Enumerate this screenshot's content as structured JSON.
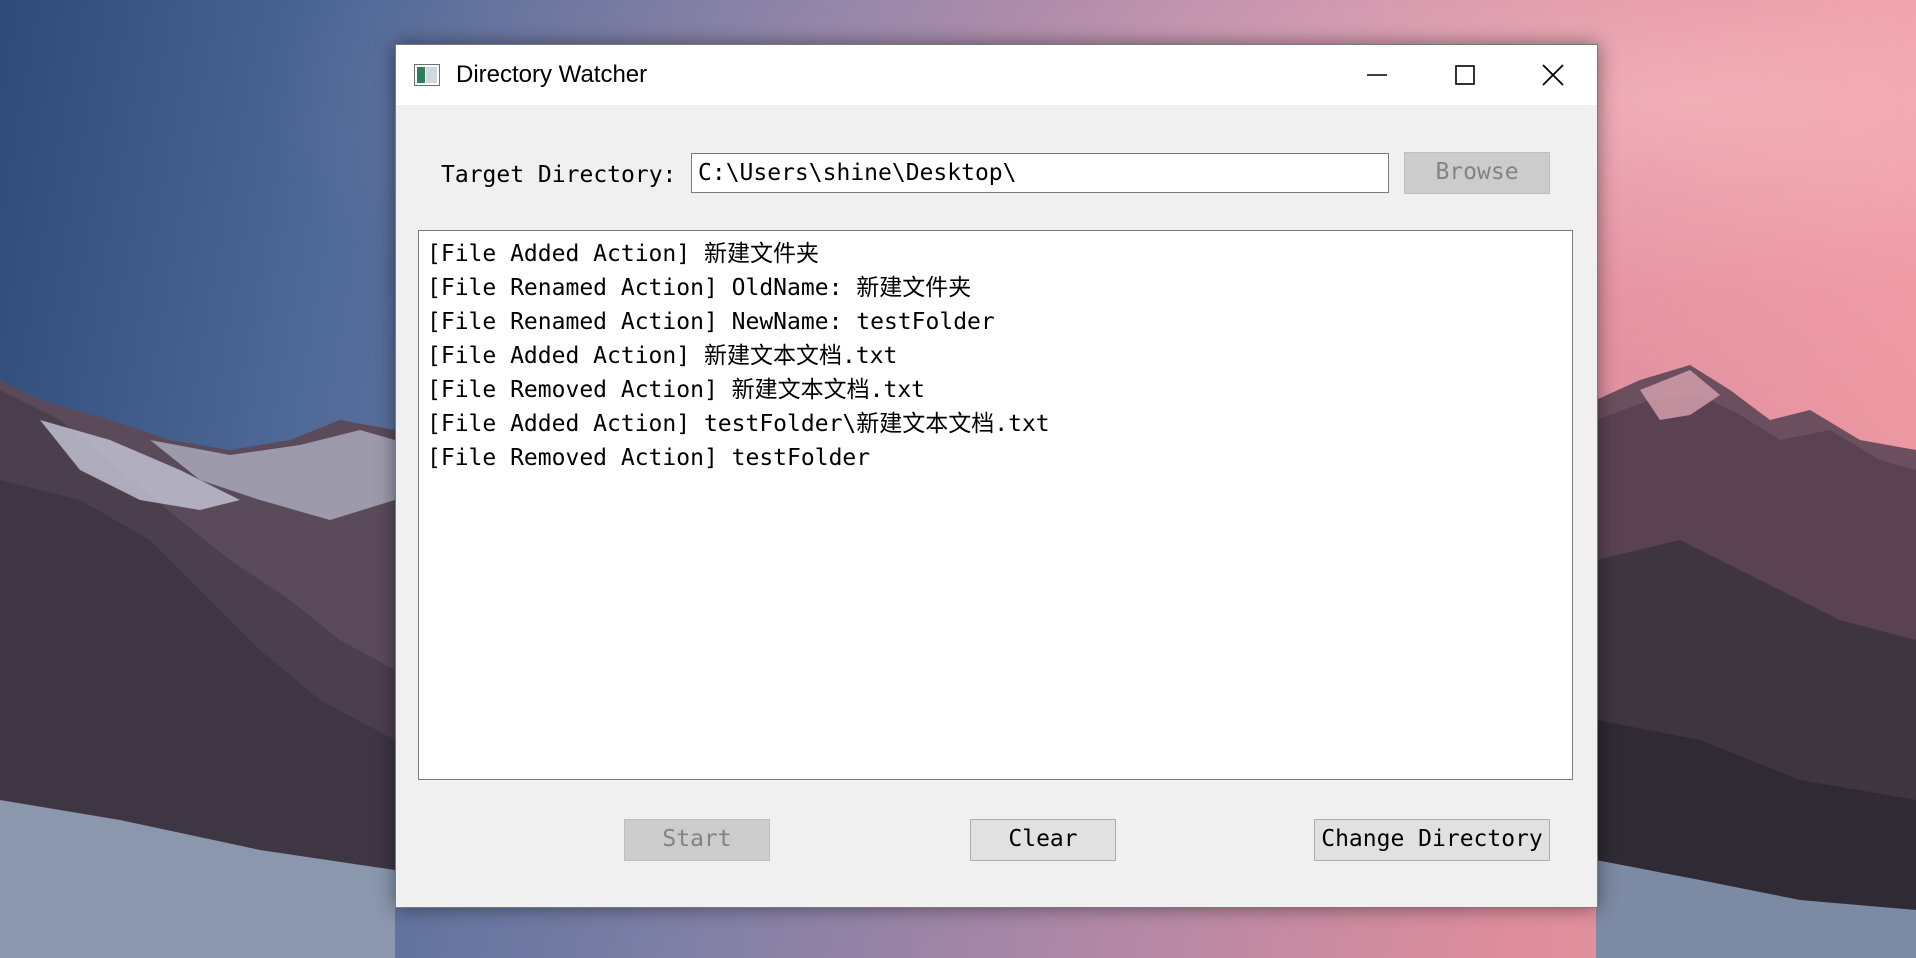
{
  "window": {
    "title": "Directory Watcher"
  },
  "form": {
    "target_label": "Target Directory:",
    "directory_value": "C:\\Users\\shine\\Desktop\\",
    "browse_label": "Browse"
  },
  "log": {
    "lines": [
      "[File Added Action] 新建文件夹",
      "[File Renamed Action] OldName: 新建文件夹",
      "[File Renamed Action] NewName: testFolder",
      "[File Added Action] 新建文本文档.txt",
      "[File Removed Action] 新建文本文档.txt",
      "[File Added Action] testFolder\\新建文本文档.txt",
      "[File Removed Action] testFolder"
    ]
  },
  "buttons": {
    "start_label": "Start",
    "clear_label": "Clear",
    "change_label": "Change Directory"
  },
  "icons": {
    "app": "app-window-icon",
    "minimize": "minimize-icon",
    "maximize": "maximize-icon",
    "close": "close-icon"
  },
  "colors": {
    "window_bg": "#f0f0f0",
    "disabled_button_bg": "#cccccc",
    "button_bg": "#e1e1e1"
  }
}
